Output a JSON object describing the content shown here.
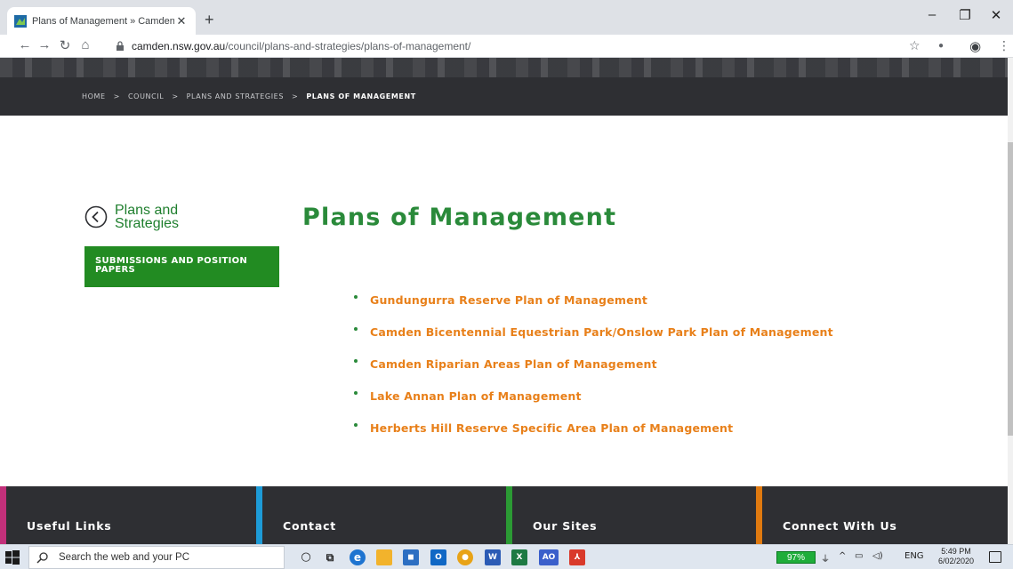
{
  "browser": {
    "tab_title": "Plans of Management » Camden",
    "tab_close": "✕",
    "new_tab": "+",
    "url_domain": "camden.nsw.gov.au",
    "url_path": "/council/plans-and-strategies/plans-of-management/",
    "window_controls": {
      "minimize": "–",
      "maximize": "❐",
      "close": "✕"
    }
  },
  "header": {
    "breadcrumb": [
      "HOME",
      "COUNCIL",
      "PLANS AND STRATEGIES"
    ],
    "breadcrumb_current": "PLANS OF MANAGEMENT",
    "breadcrumb_separator": ">"
  },
  "sidebar": {
    "back_label_line1": "Plans and",
    "back_label_line2": "Strategies",
    "button_line1": "SUBMISSIONS AND POSITION",
    "button_line2": "PAPERS"
  },
  "main": {
    "title": "Plans of Management",
    "documents": [
      "Gundungurra Reserve Plan of Management",
      "Camden Bicentennial Equestrian Park/Onslow Park Plan of Management",
      "Camden Riparian Areas Plan of Management",
      "Lake Annan Plan of Management",
      "Herberts Hill Reserve Specific Area Plan of Management"
    ]
  },
  "footer": {
    "columns": [
      {
        "heading": "Useful Links",
        "accent": "#c2307a"
      },
      {
        "heading": "Contact",
        "accent": "#1d9bd7"
      },
      {
        "heading": "Our Sites",
        "accent": "#2b9a34"
      },
      {
        "heading": "Connect With Us",
        "accent": "#e07a10"
      }
    ]
  },
  "taskbar": {
    "search_placeholder": "Search the web and your PC",
    "battery": "97%",
    "language": "ENG",
    "time": "5:49 PM",
    "date": "6/02/2020"
  },
  "colors": {
    "brand_green": "#2a8a3a",
    "link_orange": "#e8801a",
    "header_dark": "#2e2f33"
  }
}
